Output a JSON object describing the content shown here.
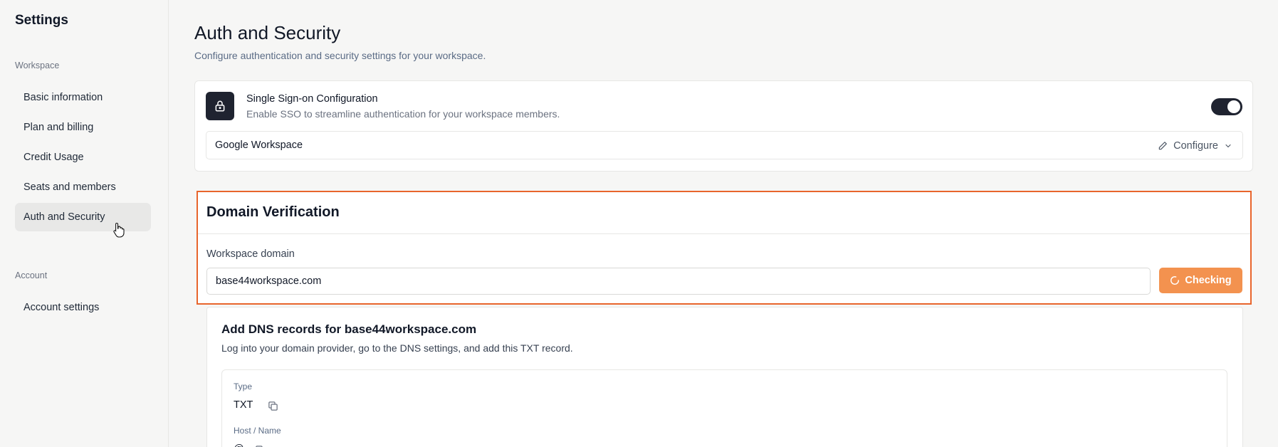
{
  "sidebar": {
    "title": "Settings",
    "workspace_label": "Workspace",
    "items": [
      {
        "label": "Basic information"
      },
      {
        "label": "Plan and billing"
      },
      {
        "label": "Credit Usage"
      },
      {
        "label": "Seats and members"
      },
      {
        "label": "Auth and Security",
        "active": true
      }
    ],
    "account_label": "Account",
    "account_items": [
      {
        "label": "Account settings"
      }
    ]
  },
  "header": {
    "title": "Auth and Security",
    "subtitle": "Configure authentication and security settings for your workspace."
  },
  "sso": {
    "icon": "lock-icon",
    "title": "Single Sign-on Configuration",
    "description": "Enable SSO to streamline authentication for your workspace members.",
    "enabled": true,
    "provider": "Google Workspace",
    "configure_label": "Configure"
  },
  "domain": {
    "title": "Domain Verification",
    "field_label": "Workspace domain",
    "value": "base44workspace.com",
    "button_label": "Checking",
    "highlight_color": "#e8652c",
    "button_color": "#f3924f"
  },
  "dns": {
    "title": "Add DNS records for base44workspace.com",
    "description": "Log into your domain provider, go to the DNS settings, and add this TXT record.",
    "type_label": "Type",
    "type_value": "TXT",
    "host_label": "Host / Name",
    "host_value": "@"
  }
}
